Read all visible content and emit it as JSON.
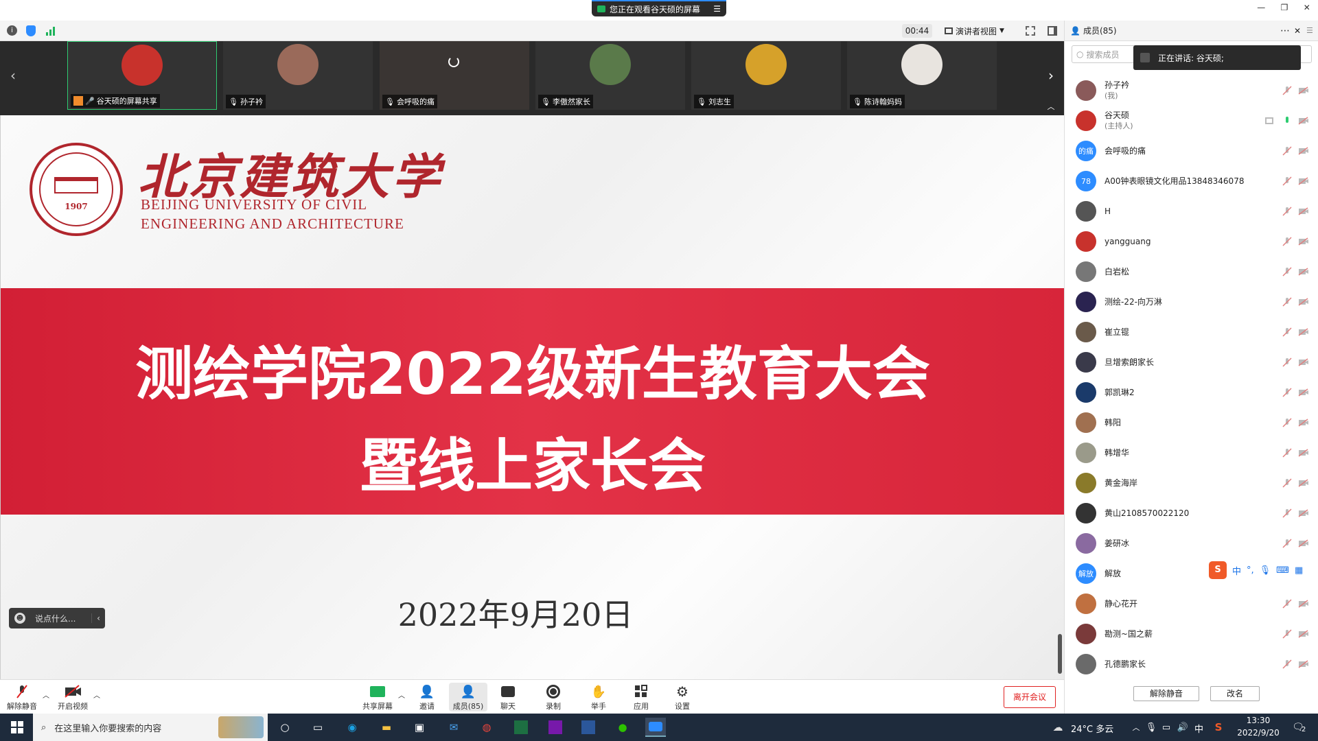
{
  "banner": {
    "text": "您正在观看谷天硕的屏幕"
  },
  "window": {
    "min": "—",
    "restore": "❐",
    "close": "✕"
  },
  "topbar": {
    "timer": "00:44",
    "view_label": "演讲者视图"
  },
  "thumbnails": [
    {
      "label": "谷天硕的屏幕共享",
      "color": "#c8322c"
    },
    {
      "label": "孙子衿",
      "color": "#9a6a5a"
    },
    {
      "label": "会呼吸的痛",
      "color": "#3a3533"
    },
    {
      "label": "李傲然家长",
      "color": "#5a7a4a"
    },
    {
      "label": "刘志生",
      "color": "#d6a12a"
    },
    {
      "label": "陈诗翰妈妈",
      "color": "#e8e4df"
    }
  ],
  "slide": {
    "uni_cn": "北京建筑大学",
    "uni_en1": "BEIJING UNIVERSITY OF CIVIL",
    "uni_en2": "ENGINEERING AND ARCHITECTURE",
    "seal_year": "1907",
    "title1": "测绘学院2022级新生教育大会",
    "title2": "暨线上家长会",
    "date": "2022年9月20日"
  },
  "chatbox": {
    "placeholder": "说点什么..."
  },
  "panel": {
    "title": "成员(85)",
    "search_placeholder": "搜索成员",
    "speaking": "正在讲话: 谷天硕;",
    "members": [
      {
        "name": "孙子衿",
        "sub": "(我)",
        "avatar_color": "#8a5a5a",
        "avatar_text": ""
      },
      {
        "name": "谷天硕",
        "sub": "(主持人)",
        "avatar_color": "#c8322c",
        "avatar_text": ""
      },
      {
        "name": "会呼吸的痛",
        "sub": "",
        "avatar_color": "#2d8cff",
        "avatar_text": "的痛"
      },
      {
        "name": "A00钟表眼镜文化用品13848346078",
        "sub": "",
        "avatar_color": "#2d8cff",
        "avatar_text": "78"
      },
      {
        "name": "H",
        "sub": "",
        "avatar_color": "#555555",
        "avatar_text": ""
      },
      {
        "name": "yangguang",
        "sub": "",
        "avatar_color": "#c8322c",
        "avatar_text": ""
      },
      {
        "name": "白岩松",
        "sub": "",
        "avatar_color": "#777777",
        "avatar_text": ""
      },
      {
        "name": "测绘-22-向万淋",
        "sub": "",
        "avatar_color": "#2a2350",
        "avatar_text": ""
      },
      {
        "name": "崔立锟",
        "sub": "",
        "avatar_color": "#6a5a4a",
        "avatar_text": ""
      },
      {
        "name": "旦增索朗家长",
        "sub": "",
        "avatar_color": "#3a3a4a",
        "avatar_text": ""
      },
      {
        "name": "郭凯琳2",
        "sub": "",
        "avatar_color": "#1a3a6a",
        "avatar_text": ""
      },
      {
        "name": "韩阳",
        "sub": "",
        "avatar_color": "#a07050",
        "avatar_text": ""
      },
      {
        "name": "韩增华",
        "sub": "",
        "avatar_color": "#9a9a8a",
        "avatar_text": ""
      },
      {
        "name": "黄金海岸",
        "sub": "",
        "avatar_color": "#8a7a2a",
        "avatar_text": ""
      },
      {
        "name": "黄山2108570022120",
        "sub": "",
        "avatar_color": "#333333",
        "avatar_text": ""
      },
      {
        "name": "姜研冰",
        "sub": "",
        "avatar_color": "#8a6aa0",
        "avatar_text": ""
      },
      {
        "name": "解放",
        "sub": "",
        "avatar_color": "#2d8cff",
        "avatar_text": "解放"
      },
      {
        "name": "静心花开",
        "sub": "",
        "avatar_color": "#c07040",
        "avatar_text": ""
      },
      {
        "name": "勘测~国之薪",
        "sub": "",
        "avatar_color": "#7a3a3a",
        "avatar_text": ""
      },
      {
        "name": "孔德鹏家长",
        "sub": "",
        "avatar_color": "#6a6a6a",
        "avatar_text": ""
      }
    ],
    "unmute_all": "解除静音",
    "rename": "改名"
  },
  "ime": {
    "logo": "S",
    "lang": "中",
    "punct": "°,"
  },
  "toolbar": {
    "unmute": "解除静音",
    "start_video": "开启视频",
    "share": "共享屏幕",
    "invite": "邀请",
    "members": "成员(85)",
    "chat": "聊天",
    "record": "录制",
    "raise_hand": "举手",
    "apps": "应用",
    "settings": "设置",
    "leave": "离开会议"
  },
  "taskbar": {
    "search_placeholder": "在这里输入你要搜索的内容",
    "weather": "24°C 多云",
    "ime_lang": "中",
    "time": "13:30",
    "date": "2022/9/20",
    "notifications": "2"
  }
}
